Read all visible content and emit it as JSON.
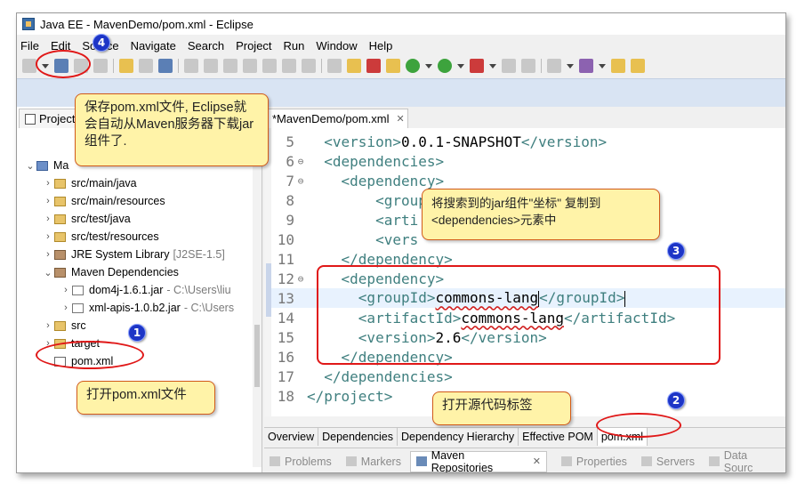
{
  "window": {
    "title": "Java EE - MavenDemo/pom.xml - Eclipse"
  },
  "menu": [
    "File",
    "Edit",
    "Source",
    "Navigate",
    "Search",
    "Project",
    "Run",
    "Window",
    "Help"
  ],
  "explorer": {
    "tab_label": "Project",
    "project_label": "Ma",
    "items": [
      {
        "label": "src/main/java",
        "extra": ""
      },
      {
        "label": "src/main/resources",
        "extra": ""
      },
      {
        "label": "src/test/java",
        "extra": ""
      },
      {
        "label": "src/test/resources",
        "extra": ""
      },
      {
        "label": "JRE System Library",
        "extra": "[J2SE-1.5]"
      },
      {
        "label": "Maven Dependencies",
        "extra": ""
      },
      {
        "label": "dom4j-1.6.1.jar",
        "extra": "- C:\\Users\\liu"
      },
      {
        "label": "xml-apis-1.0.b2.jar",
        "extra": "- C:\\Users"
      },
      {
        "label": "src",
        "extra": ""
      },
      {
        "label": "target",
        "extra": ""
      },
      {
        "label": "pom.xml",
        "extra": ""
      }
    ]
  },
  "editor": {
    "tab_label": "*MavenDemo/pom.xml",
    "lines": [
      {
        "no": "5",
        "fold": "",
        "indent": "  ",
        "open": "<version>",
        "text": "0.0.1-SNAPSHOT",
        "close": "</version>"
      },
      {
        "no": "6",
        "fold": "⊖",
        "indent": "  ",
        "open": "<dependencies>",
        "text": "",
        "close": ""
      },
      {
        "no": "7",
        "fold": "⊖",
        "indent": "    ",
        "open": "<dependency>",
        "text": "",
        "close": ""
      },
      {
        "no": "8",
        "fold": "",
        "indent": "        ",
        "open": "<group",
        "text": "",
        "close": ""
      },
      {
        "no": "9",
        "fold": "",
        "indent": "        ",
        "open": "<arti",
        "text": "",
        "close": ""
      },
      {
        "no": "10",
        "fold": "",
        "indent": "        ",
        "open": "<vers",
        "text": "",
        "close": ""
      },
      {
        "no": "11",
        "fold": "",
        "indent": "    ",
        "open": "</dependency>",
        "text": "",
        "close": ""
      },
      {
        "no": "12",
        "fold": "⊖",
        "indent": "    ",
        "open": "<dependency>",
        "text": "",
        "close": ""
      },
      {
        "no": "13",
        "fold": "",
        "indent": "      ",
        "open": "<groupId>",
        "text": "commons-lang",
        "close": "</groupId>"
      },
      {
        "no": "14",
        "fold": "",
        "indent": "      ",
        "open": "<artifactId>",
        "text": "commons-lang",
        "close": "</artifactId>"
      },
      {
        "no": "15",
        "fold": "",
        "indent": "      ",
        "open": "<version>",
        "text": "2.6",
        "close": "</version>"
      },
      {
        "no": "16",
        "fold": "",
        "indent": "    ",
        "open": "</dependency>",
        "text": "",
        "close": ""
      },
      {
        "no": "17",
        "fold": "",
        "indent": "  ",
        "open": "</dependencies>",
        "text": "",
        "close": ""
      },
      {
        "no": "18",
        "fold": "",
        "indent": "",
        "open": "</project>",
        "text": "",
        "close": ""
      }
    ],
    "current_line": "13"
  },
  "pom_tabs": [
    "Overview",
    "Dependencies",
    "Dependency Hierarchy",
    "Effective POM",
    "pom.xml"
  ],
  "pom_tabs_active": "pom.xml",
  "bottom_tabs": [
    {
      "label": "Problems",
      "active": false
    },
    {
      "label": "Markers",
      "active": false
    },
    {
      "label": "Maven Repositories",
      "active": true
    },
    {
      "label": "Properties",
      "active": false
    },
    {
      "label": "Servers",
      "active": false
    },
    {
      "label": "Data Sourc",
      "active": false
    }
  ],
  "annotations": {
    "save_note": "保存pom.xml文件, Eclipse就会自动从Maven服务器下载jar组件了.",
    "open_pom_note": "打开pom.xml文件",
    "copy_coords_note": "将搜索到的jar组件\"坐标\" 复制到<dependencies>元素中",
    "open_source_tab_note": "打开源代码标签",
    "badge_1": "1",
    "badge_2": "2",
    "badge_3": "3",
    "badge_4": "4"
  },
  "colors": {
    "tag": "#3f7f7f",
    "callout_bg": "#fff3a8",
    "ring": "#e01818",
    "badge": "#1d35c6"
  }
}
